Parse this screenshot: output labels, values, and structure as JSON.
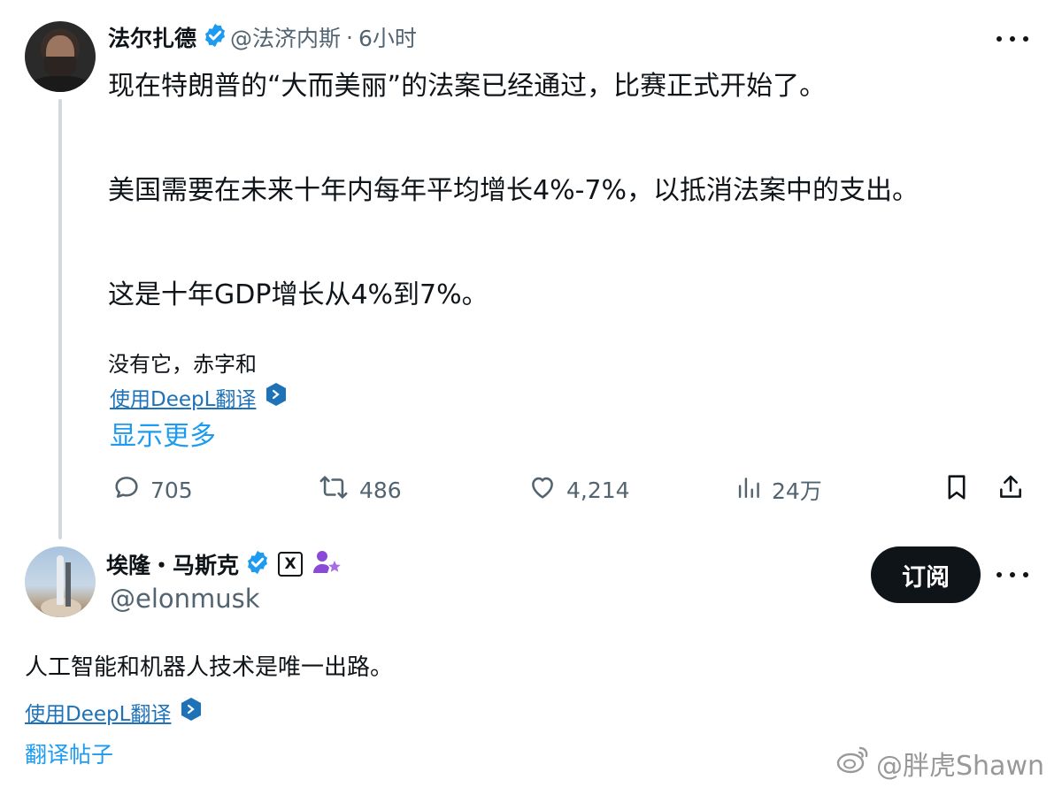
{
  "tweet1": {
    "author_name": "法尔扎德",
    "handle": "@法济内斯",
    "separator": "·",
    "time": "6小时",
    "paragraphs": [
      "现在特朗普的“大而美丽”的法案已经通过，比赛正式开始了。",
      "美国需要在未来十年内每年平均增长4%-7%，以抵消法案中的支出。",
      "这是十年GDP增长从4%到7%。",
      "没有它，赤字和"
    ],
    "translate_link": "使用DeepL翻译",
    "show_more": "显示更多",
    "stats": {
      "replies": "705",
      "reposts": "486",
      "likes": "4,214",
      "views": "24万"
    }
  },
  "tweet2": {
    "author_name": "埃隆・马斯克",
    "x_badge": "X",
    "handle": "@elonmusk",
    "subscribe_label": "订阅",
    "text": "人工智能和机器人技术是唯一出路。",
    "translate_link": "使用DeepL翻译",
    "translate_post": "翻译帖子"
  },
  "watermark": "@胖虎Shawn",
  "colors": {
    "text": "#0f1419",
    "secondary": "#536471",
    "link": "#1d9bf0",
    "verified": "#1d9bf0",
    "thread_line": "#cfd9de"
  },
  "icons": {
    "reply": "reply-icon",
    "repost": "repost-icon",
    "like": "heart-icon",
    "views": "views-icon",
    "bookmark": "bookmark-icon",
    "share": "share-icon"
  }
}
